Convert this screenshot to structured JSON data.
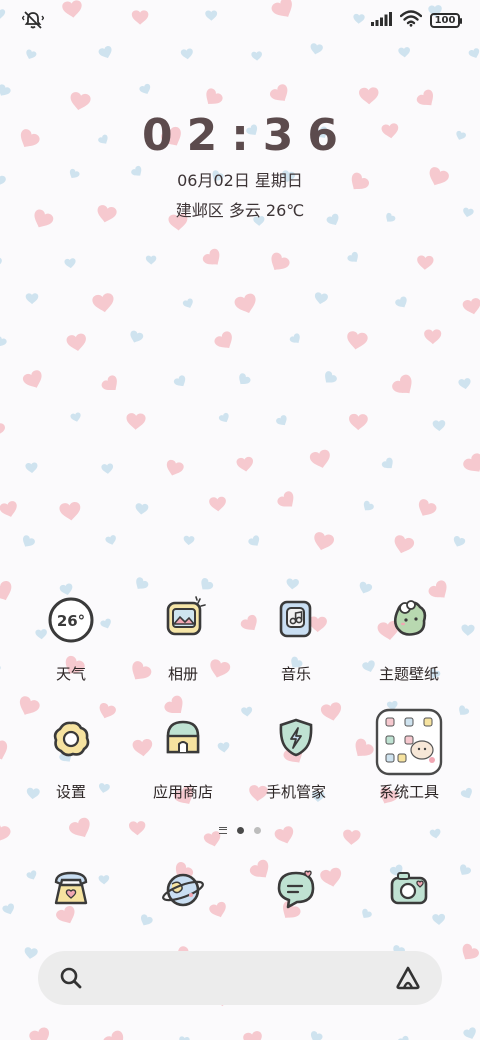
{
  "status_bar": {
    "left_icon": "mute-vibrate-icon",
    "signal_icon": "signal-bars-icon",
    "wifi_icon": "wifi-icon",
    "battery_level": "100"
  },
  "clock": {
    "time": "02:36",
    "date": "06月02日 星期日",
    "weather": "建邺区 多云 26℃"
  },
  "weather_icon_text": "26°",
  "apps": [
    {
      "label": "天气",
      "icon": "weather-icon"
    },
    {
      "label": "相册",
      "icon": "gallery-icon"
    },
    {
      "label": "音乐",
      "icon": "music-icon"
    },
    {
      "label": "主题壁纸",
      "icon": "theme-icon"
    },
    {
      "label": "设置",
      "icon": "settings-icon"
    },
    {
      "label": "应用商店",
      "icon": "app-store-icon"
    },
    {
      "label": "手机管家",
      "icon": "security-icon"
    },
    {
      "label": "系统工具",
      "icon": "system-tools-folder-icon"
    }
  ],
  "dock": [
    {
      "icon": "phone-icon"
    },
    {
      "icon": "browser-icon"
    },
    {
      "icon": "messages-icon"
    },
    {
      "icon": "camera-icon"
    }
  ],
  "page_indicator": {
    "pages": 2,
    "current": 1
  },
  "search_bar": {
    "left_icon": "search-icon",
    "right_icon": "assistant-icon"
  },
  "colors": {
    "heart_pink": "#f6c9cf",
    "heart_blue": "#cfe3ef",
    "clock_text": "#5c4b4d",
    "search_bg": "#ececec"
  }
}
